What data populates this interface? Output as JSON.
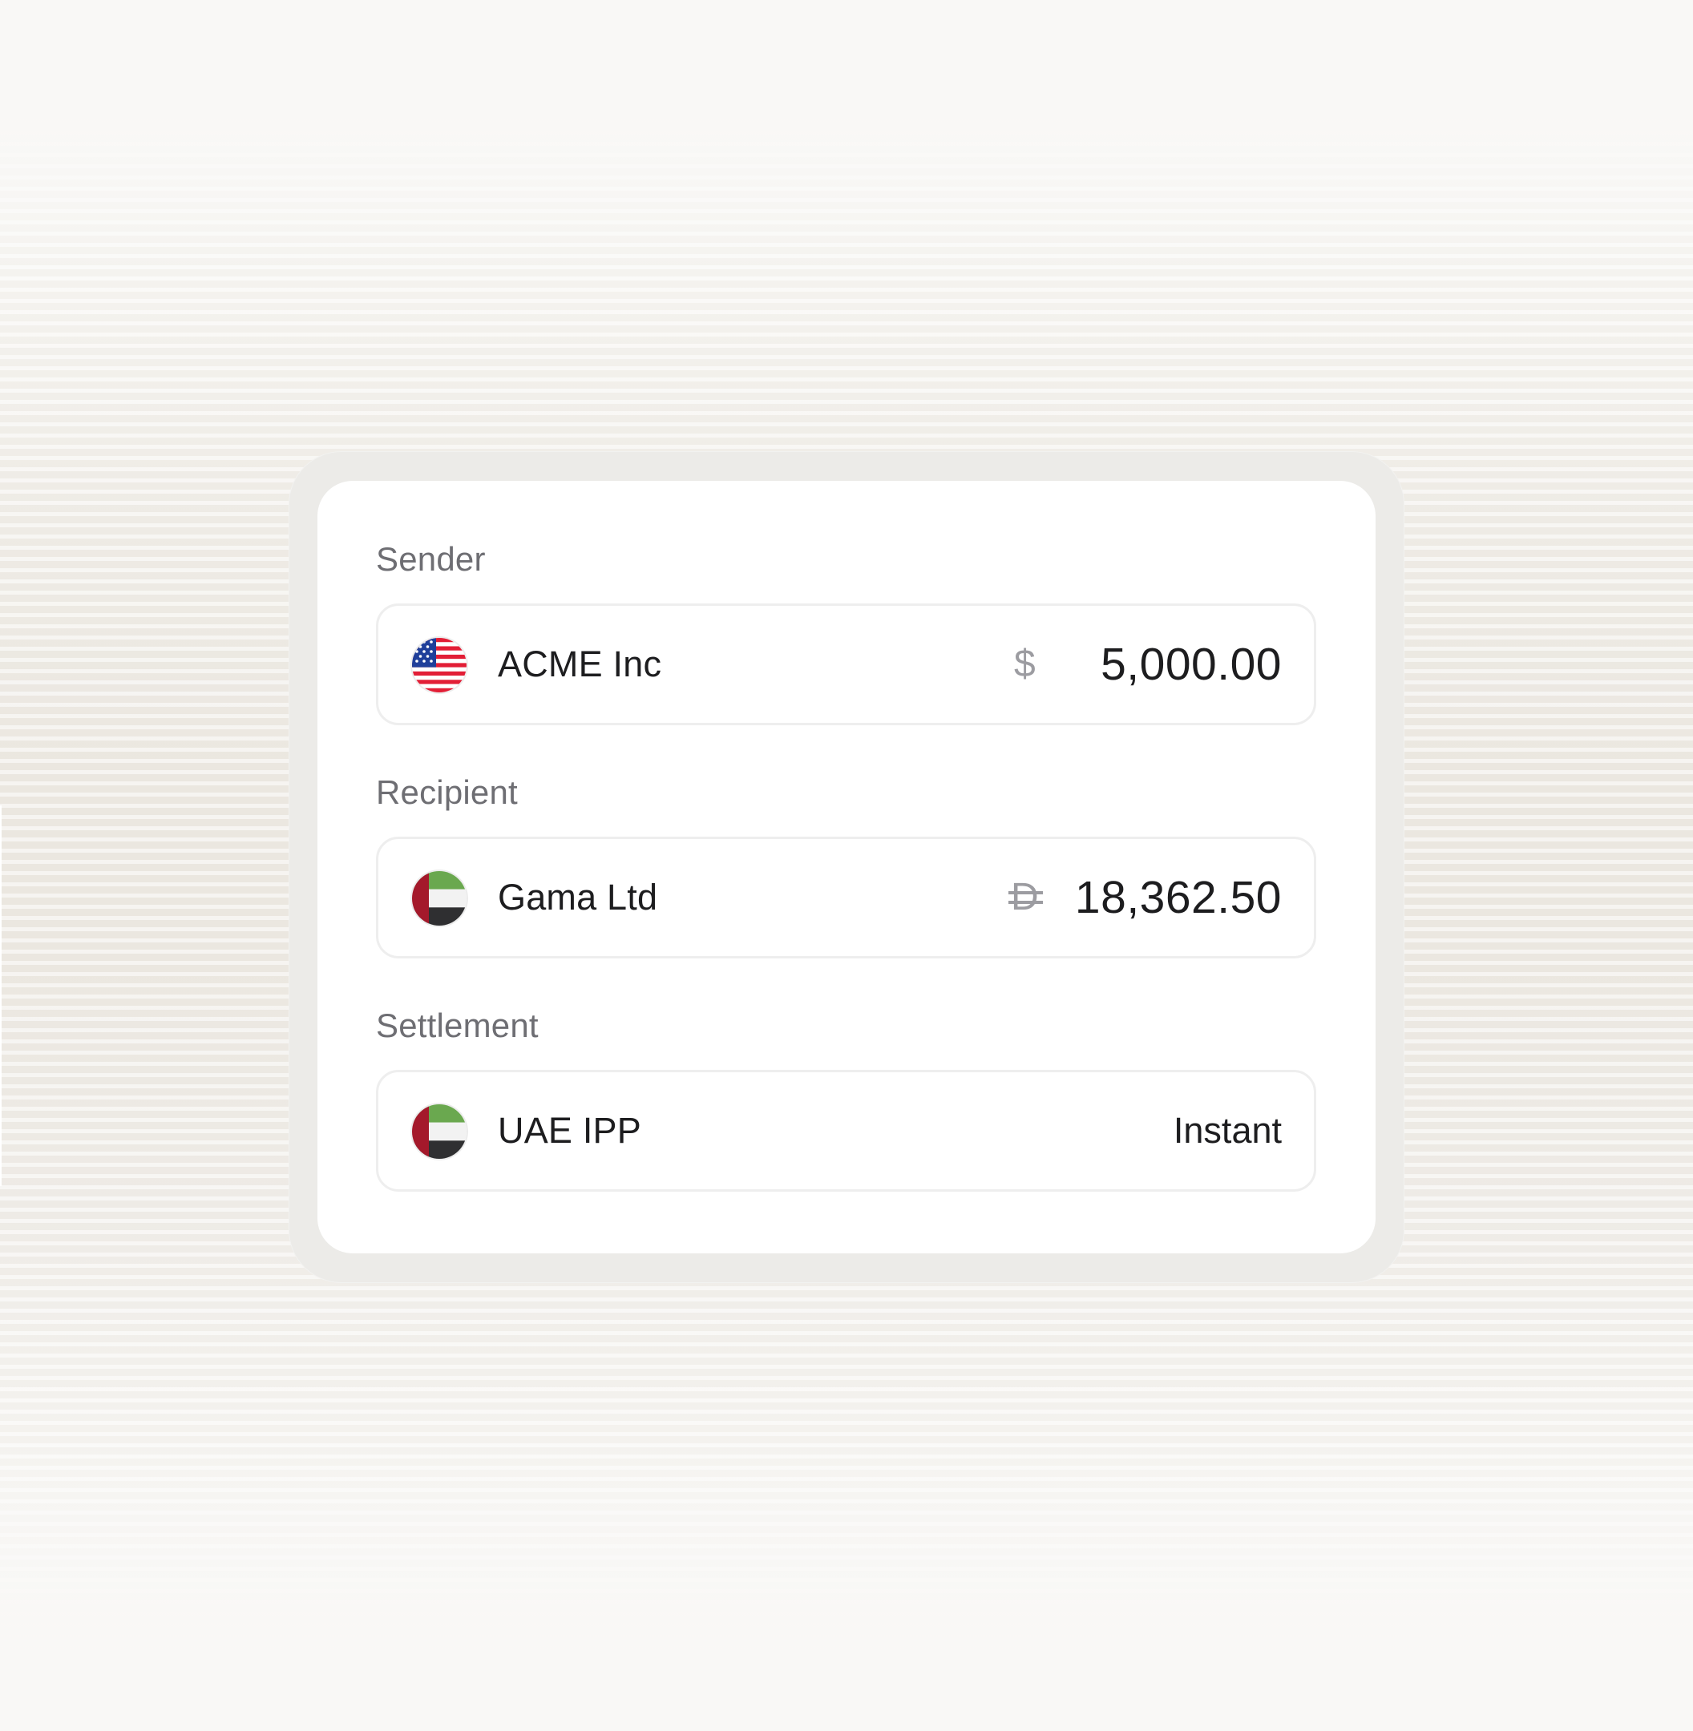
{
  "sender": {
    "label": "Sender",
    "name": "ACME Inc",
    "flag_icon": "us-flag-icon",
    "currency_symbol": "$",
    "amount": "5,000.00"
  },
  "recipient": {
    "label": "Recipient",
    "name": "Gama Ltd",
    "flag_icon": "uae-flag-icon",
    "currency_symbol": "D",
    "amount": "18,362.50"
  },
  "settlement": {
    "label": "Settlement",
    "name": "UAE IPP",
    "flag_icon": "uae-flag-icon",
    "status": "Instant"
  },
  "colors": {
    "text_primary": "#1d1d1f",
    "text_secondary": "#6e6e73",
    "currency_symbol": "#9c9ca1",
    "row_border": "#eeeeee",
    "card_bg": "#ffffff"
  }
}
